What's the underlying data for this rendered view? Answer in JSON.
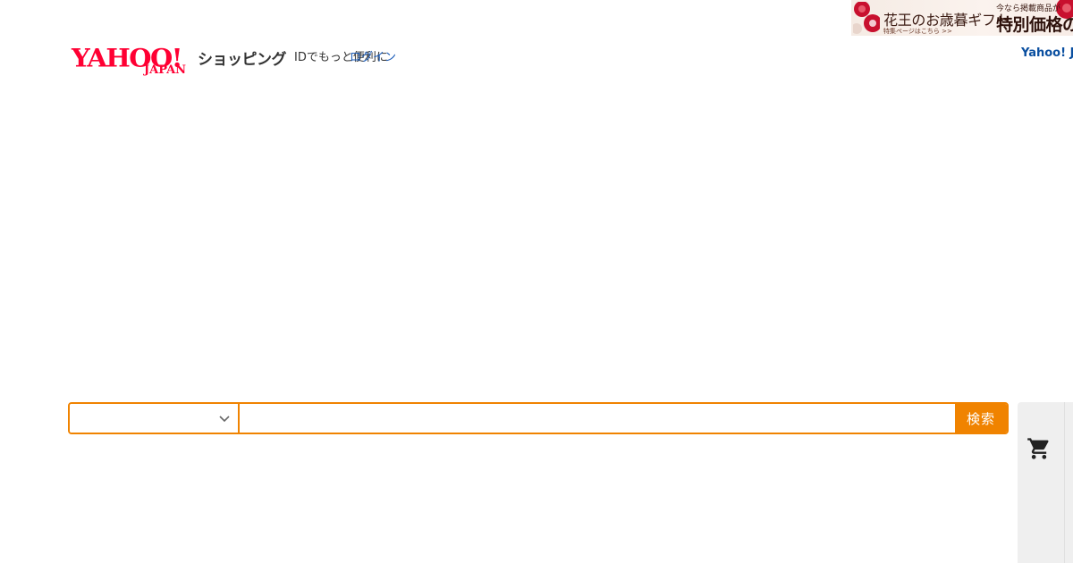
{
  "promo_banner": {
    "title": "花王のお歳暮ギフト",
    "note": "今なら掲載商品が",
    "price_text": "特別価格の",
    "link_text": "特集ページはこちら >>",
    "colors": {
      "background": "#f5ebe4",
      "flower": "#c8102e"
    }
  },
  "header": {
    "logo_main": "YAHOO!",
    "logo_sub": "JAPAN",
    "service_name": "ショッピング",
    "id_text": "IDでもっと便利に",
    "login_label": "ログイン",
    "yahoo_link": "Yahoo! JAPAN"
  },
  "search": {
    "category_value": "",
    "query_value": "",
    "query_placeholder": "",
    "button_label": "検索",
    "accent_color": "#f08300"
  },
  "cart": {
    "icon": "cart-icon",
    "panel_color": "#efefef"
  },
  "colors": {
    "logo_red": "#ff0033",
    "link_blue": "#1a5bb8",
    "accent_orange": "#f08300"
  }
}
